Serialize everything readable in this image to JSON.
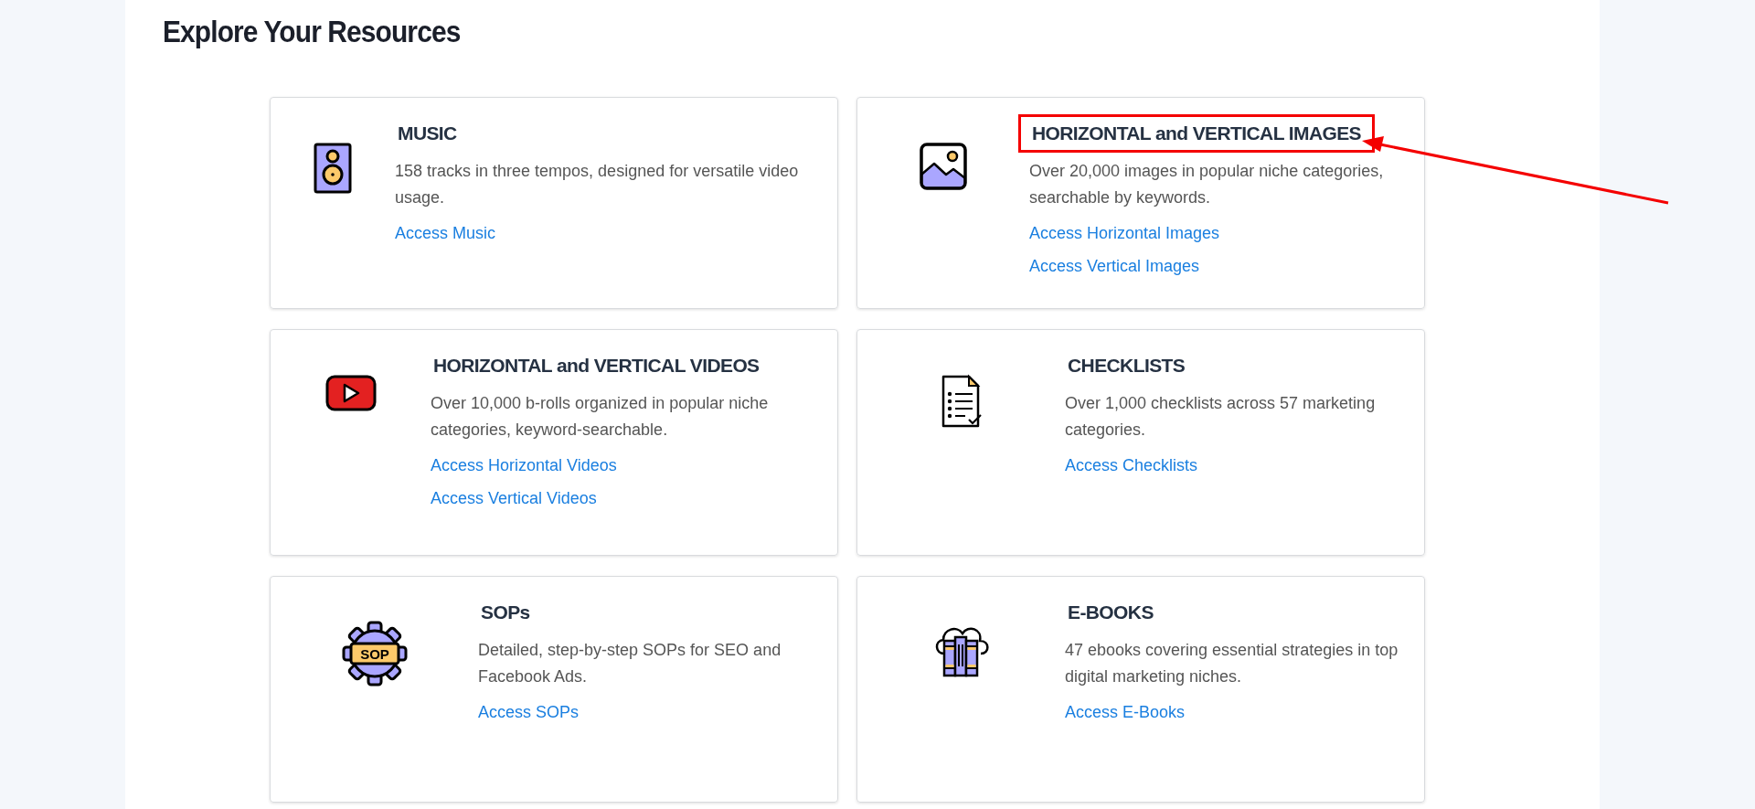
{
  "heading": "Explore Your Resources",
  "cards": [
    {
      "title": "MUSIC",
      "highlighted": false,
      "description": "158 tracks in three tempos, designed for versatile video usage.",
      "links": [
        "Access Music"
      ]
    },
    {
      "title": "HORIZONTAL and VERTICAL IMAGES",
      "highlighted": true,
      "description": "Over 20,000 images in popular niche categories, searchable by keywords.",
      "links": [
        "Access Horizontal Images",
        "Access Vertical Images"
      ]
    },
    {
      "title": "HORIZONTAL and VERTICAL VIDEOS",
      "highlighted": false,
      "description": "Over 10,000 b-rolls organized in popular niche categories, keyword-searchable.",
      "links": [
        "Access Horizontal Videos",
        "Access Vertical Videos"
      ]
    },
    {
      "title": "CHECKLISTS",
      "highlighted": false,
      "description": "Over 1,000 checklists across 57 marketing categories.",
      "links": [
        "Access Checklists"
      ]
    },
    {
      "title": "SOPs",
      "highlighted": false,
      "icon_text": "SOP",
      "description": "Detailed, step-by-step SOPs for SEO and Facebook Ads.",
      "links": [
        "Access SOPs"
      ]
    },
    {
      "title": "E-BOOKS",
      "highlighted": false,
      "description": "47 ebooks covering essential strategies in top digital marketing niches.",
      "links": [
        "Access E-Books"
      ]
    }
  ]
}
